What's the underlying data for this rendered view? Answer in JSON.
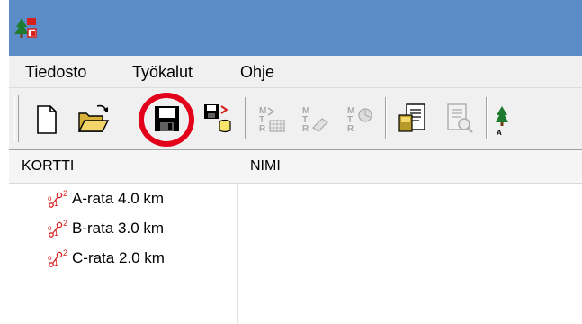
{
  "menu": {
    "items": [
      {
        "label": "Tiedosto"
      },
      {
        "label": "Työkalut"
      },
      {
        "label": "Ohje"
      }
    ]
  },
  "toolbar": {
    "buttons": [
      {
        "icon": "new-file-icon"
      },
      {
        "icon": "open-folder-icon"
      },
      {
        "icon": "save-icon",
        "highlighted": true
      },
      {
        "icon": "save-to-database-icon"
      },
      {
        "icon": "mtr-table-icon",
        "text": "MTR"
      },
      {
        "icon": "mtr-erase-icon",
        "text": "MTR"
      },
      {
        "icon": "mtr-reader-icon",
        "text": "MTR"
      },
      {
        "icon": "print-document-icon"
      },
      {
        "icon": "print-preview-icon"
      },
      {
        "icon": "tree-icon"
      }
    ],
    "highlight_color": "#e2001a"
  },
  "list": {
    "columns": [
      "KORTTI",
      "NIMI"
    ],
    "rows": [
      {
        "kortti": "A-rata 4.0 km",
        "nimi": ""
      },
      {
        "kortti": "B-rata 3.0 km",
        "nimi": ""
      },
      {
        "kortti": "C-rata 2.0 km",
        "nimi": ""
      }
    ],
    "row_icon": "control-card-icon"
  },
  "colors": {
    "titlebar": "#5c8cc8",
    "accent_red": "#e2001a"
  }
}
